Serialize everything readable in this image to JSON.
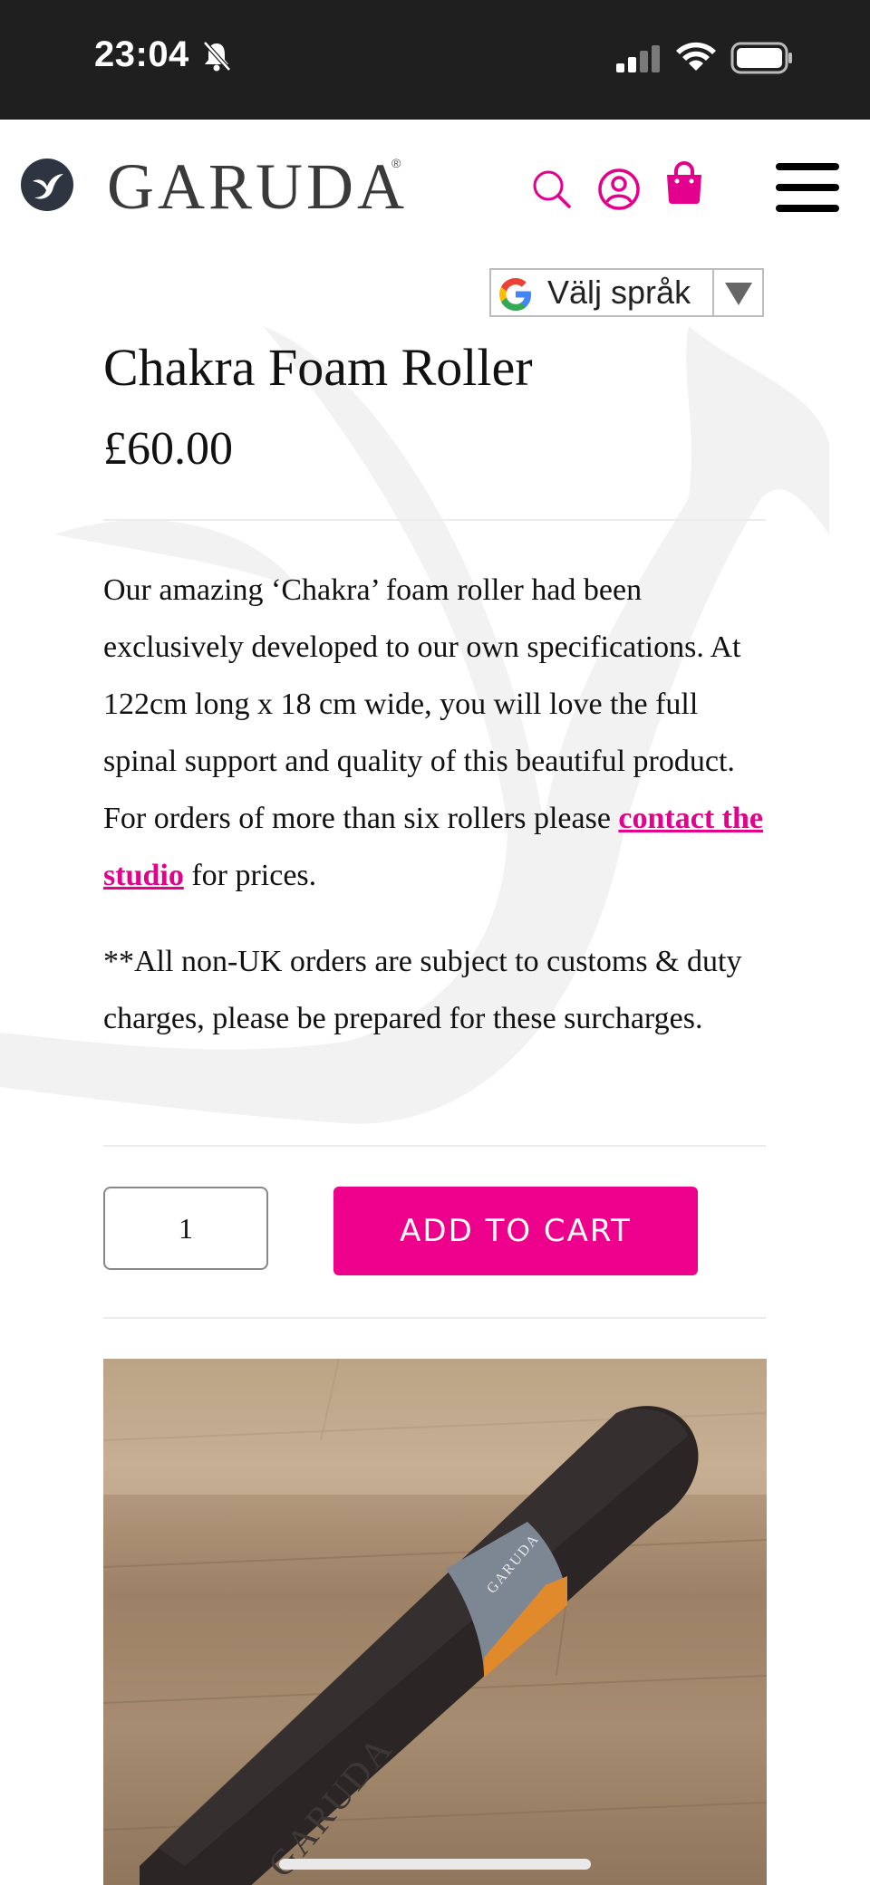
{
  "status_bar": {
    "time": "23:04"
  },
  "header": {
    "logo_text": "GARUDA",
    "logo_reg": "®"
  },
  "translate": {
    "label": "Välj språk"
  },
  "product": {
    "title": "Chakra Foam Roller",
    "price": "£60.00",
    "description_before_link": "Our amazing ‘Chakra’ foam roller had been exclusively developed to our own specifications. At 122cm long x 18 cm wide, you will love the full spinal support and quality of this beautiful product. For orders of more than six rollers please ",
    "description_link": "contact the studio",
    "description_after_link": " for prices.",
    "note": "**All non-UK orders are subject to customs & duty charges, please be prepared for these surcharges.",
    "quantity": "1",
    "add_to_cart": "ADD TO CART",
    "image_label": "GARUDA"
  },
  "colors": {
    "accent": "#ec008c",
    "link": "#e3008c",
    "status_bar": "#1f1f1f"
  }
}
